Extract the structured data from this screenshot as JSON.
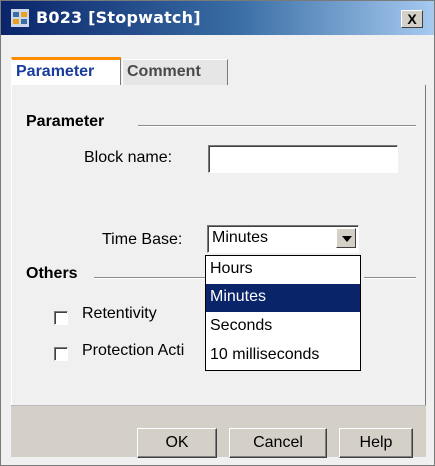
{
  "window": {
    "title": "B023 [Stopwatch]",
    "close_label": "X",
    "accent_color": "#ff8c00",
    "title_gradient": [
      "#0a246a",
      "#a6caf0"
    ]
  },
  "tabs": [
    {
      "label": "Parameter",
      "active": true
    },
    {
      "label": "Comment",
      "active": false
    }
  ],
  "parameter_group": {
    "title": "Parameter",
    "block_name_label": "Block name:",
    "block_name_value": "",
    "time_base_label": "Time Base:",
    "time_base_value": "Minutes"
  },
  "dropdown": {
    "options": [
      "Hours",
      "Minutes",
      "Seconds",
      "10 milliseconds"
    ],
    "selected": "Minutes",
    "highlight_color": "#0a246a"
  },
  "others_group": {
    "title": "Others",
    "retentivity_label": "Retentivity",
    "retentivity_checked": false,
    "protection_label": "Protection Acti",
    "protection_checked": false
  },
  "buttons": {
    "ok": "OK",
    "cancel": "Cancel",
    "help": "Help"
  },
  "icons": {
    "app": "block-app-icon",
    "close": "close-icon",
    "dropdown": "chevron-down-icon"
  }
}
